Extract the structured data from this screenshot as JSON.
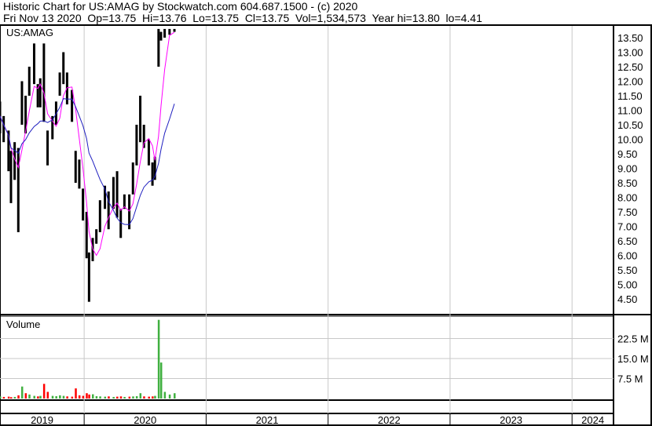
{
  "header": {
    "line1": "Historic Chart for US:AMAG by Stockwatch.com 604.687.1500 - (c) 2020",
    "line2": "Fri Nov 13 2020  Op=13.75  Hi=13.76  Lo=13.75  Cl=13.75  Vol=1,534,573  Year hi=13.80  lo=4.41"
  },
  "chart_data": {
    "type": "bar",
    "title": "US:AMAG",
    "volume_title": "Volume",
    "price_ticks": [
      "13.50",
      "13.00",
      "12.50",
      "12.00",
      "11.50",
      "11.00",
      "10.50",
      "10.00",
      "9.50",
      "9.00",
      "8.50",
      "8.00",
      "7.50",
      "7.00",
      "6.50",
      "6.00",
      "5.50",
      "5.00",
      "4.50"
    ],
    "price_range": [
      4.5,
      13.5
    ],
    "volume_ticks": [
      {
        "v": 22.5,
        "label": "22.5 M"
      },
      {
        "v": 15.0,
        "label": "15.0 M"
      },
      {
        "v": 7.5,
        "label": "7.5 M"
      }
    ],
    "volume_range_m": [
      0,
      30
    ],
    "years": [
      "2019",
      "2020",
      "2021",
      "2022",
      "2023",
      "2024"
    ],
    "x_range": [
      2019.31,
      2024.34
    ],
    "colors": {
      "price": "#000000",
      "ma_short": "#ff00ff",
      "ma_long": "#2020c0",
      "vol_up": "#40b040",
      "vol_down": "#ff0000"
    },
    "ma_periods": [
      4,
      12
    ],
    "bars": [
      [
        2019.31,
        11.3,
        10.2,
        10.8,
        0.8
      ],
      [
        2019.34,
        10.8,
        9.9,
        10.2,
        0.6
      ],
      [
        2019.38,
        10.3,
        8.9,
        9.4,
        0.7
      ],
      [
        2019.4,
        9.6,
        7.8,
        8.4,
        0.5
      ],
      [
        2019.43,
        9.9,
        8.6,
        9.3,
        0.6
      ],
      [
        2019.46,
        9.7,
        6.8,
        9.0,
        1.2
      ],
      [
        2019.49,
        12.0,
        10.5,
        11.8,
        4.5
      ],
      [
        2019.52,
        11.5,
        10.2,
        11.0,
        2.0
      ],
      [
        2019.55,
        12.5,
        11.5,
        12.1,
        1.5
      ],
      [
        2019.59,
        13.3,
        11.9,
        12.4,
        1.0
      ],
      [
        2019.62,
        11.9,
        11.1,
        11.5,
        0.8
      ],
      [
        2019.64,
        12.1,
        11.1,
        11.6,
        1.0
      ],
      [
        2019.67,
        13.3,
        10.6,
        10.9,
        5.5
      ],
      [
        2019.7,
        10.3,
        9.1,
        9.5,
        2.5
      ],
      [
        2019.74,
        10.8,
        10.0,
        10.5,
        1.0
      ],
      [
        2019.77,
        11.3,
        10.5,
        10.9,
        0.9
      ],
      [
        2019.8,
        12.3,
        11.5,
        12.0,
        1.2
      ],
      [
        2019.83,
        13.0,
        11.9,
        12.6,
        1.0
      ],
      [
        2019.86,
        12.3,
        11.2,
        11.6,
        0.8
      ],
      [
        2019.9,
        11.7,
        10.6,
        11.0,
        0.7
      ],
      [
        2019.93,
        9.6,
        8.5,
        8.9,
        3.8
      ],
      [
        2019.96,
        9.3,
        8.3,
        8.6,
        1.2
      ],
      [
        2019.99,
        8.3,
        7.2,
        7.5,
        1.0
      ],
      [
        2020.02,
        7.5,
        5.9,
        6.3,
        2.0
      ],
      [
        2020.04,
        6.1,
        4.4,
        4.9,
        1.5
      ],
      [
        2020.07,
        6.6,
        5.8,
        6.2,
        1.6
      ],
      [
        2020.1,
        6.9,
        6.4,
        6.6,
        0.9
      ],
      [
        2020.13,
        7.9,
        6.8,
        7.2,
        0.8
      ],
      [
        2020.17,
        8.4,
        7.6,
        8.0,
        0.7
      ],
      [
        2020.2,
        8.2,
        6.9,
        7.4,
        0.8
      ],
      [
        2020.24,
        8.7,
        7.6,
        8.0,
        0.6
      ],
      [
        2020.27,
        8.9,
        7.3,
        7.8,
        0.7
      ],
      [
        2020.3,
        7.6,
        6.6,
        7.0,
        0.8
      ],
      [
        2020.33,
        8.1,
        7.6,
        7.9,
        0.6
      ],
      [
        2020.37,
        8.1,
        6.9,
        7.4,
        0.7
      ],
      [
        2020.4,
        9.2,
        8.1,
        8.8,
        0.8
      ],
      [
        2020.43,
        10.5,
        9.1,
        9.7,
        0.9
      ],
      [
        2020.46,
        11.5,
        9.9,
        11.0,
        2.0
      ],
      [
        2020.49,
        10.5,
        9.7,
        10.0,
        0.8
      ],
      [
        2020.53,
        10.0,
        9.1,
        9.4,
        0.7
      ],
      [
        2020.56,
        9.2,
        8.4,
        8.7,
        0.8
      ],
      [
        2020.58,
        9.4,
        8.6,
        9.0,
        1.0
      ],
      [
        2020.61,
        13.8,
        12.5,
        13.3,
        29.5
      ],
      [
        2020.63,
        13.7,
        13.4,
        13.6,
        13.5
      ],
      [
        2020.66,
        13.8,
        13.5,
        13.7,
        2.5
      ],
      [
        2020.7,
        13.8,
        13.6,
        13.7,
        1.5
      ],
      [
        2020.74,
        13.8,
        13.7,
        13.75,
        2.0
      ]
    ]
  }
}
